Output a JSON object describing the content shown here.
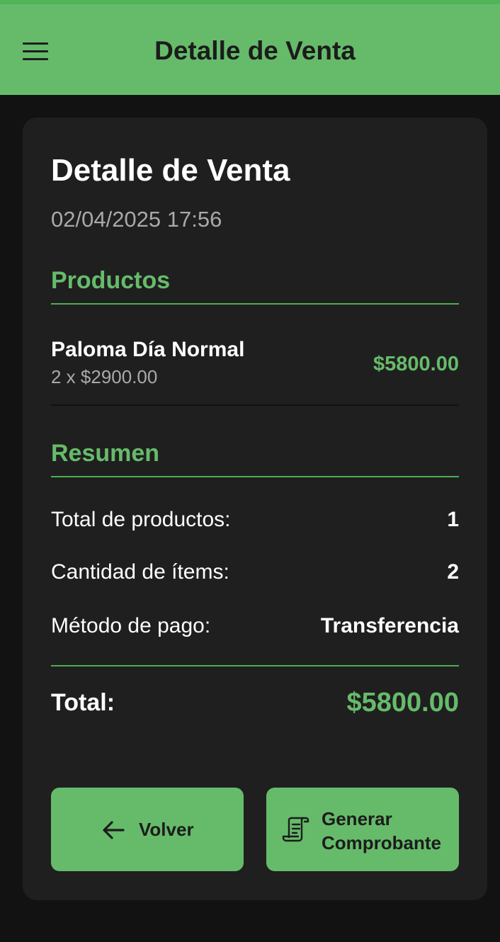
{
  "appbar": {
    "title": "Detalle de Venta",
    "menu_icon": "hamburger-menu-icon",
    "color": "#66bb6a"
  },
  "detail": {
    "title": "Detalle de Venta",
    "date": "02/04/2025 17:56"
  },
  "products": {
    "section_title": "Productos",
    "items": [
      {
        "name": "Paloma Día Normal",
        "quantity_price": "2 x $2900.00",
        "subtotal": "$5800.00"
      }
    ]
  },
  "summary": {
    "section_title": "Resumen",
    "rows": [
      {
        "label": "Total de productos:",
        "value": "1"
      },
      {
        "label": "Cantidad de ítems:",
        "value": "2"
      },
      {
        "label": "Método de pago:",
        "value": "Transferencia"
      }
    ],
    "total_label": "Total:",
    "total_value": "$5800.00"
  },
  "actions": {
    "back_label": "Volver",
    "back_icon": "arrow-left-icon",
    "receipt_label_line1": "Generar",
    "receipt_label_line2": "Comprobante",
    "receipt_icon": "receipt-icon"
  },
  "colors": {
    "accent": "#66bb6a",
    "background": "#121212",
    "card": "#1f1f1f"
  }
}
